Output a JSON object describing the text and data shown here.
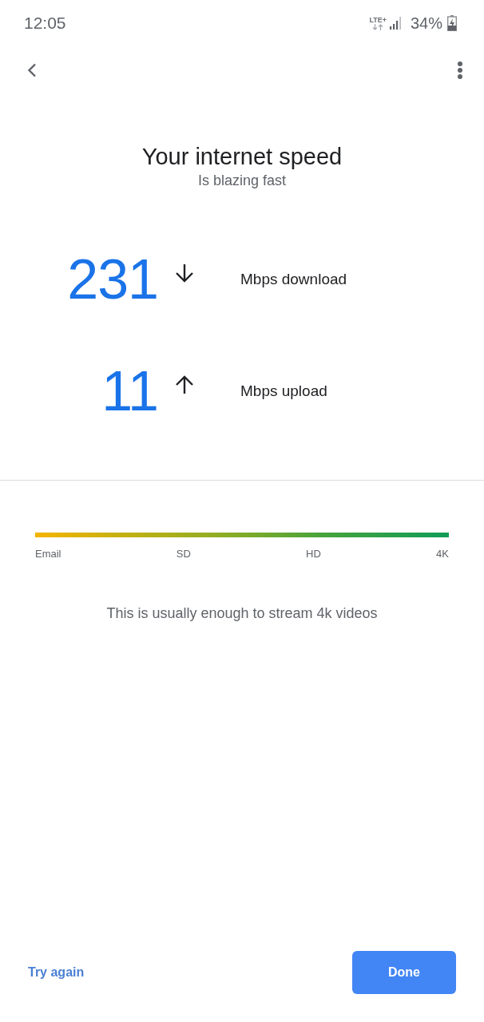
{
  "status_bar": {
    "time": "12:05",
    "network": "LTE+",
    "battery": "34%"
  },
  "header": {
    "title": "Your internet speed",
    "subtitle": "Is blazing fast"
  },
  "speeds": [
    {
      "kind": "download",
      "value": "231",
      "label": "Mbps download"
    },
    {
      "kind": "upload",
      "value": "11",
      "label": "Mbps upload"
    }
  ],
  "scale": {
    "labels": [
      "Email",
      "SD",
      "HD",
      "4K"
    ]
  },
  "message": "This is usually enough to stream 4k videos",
  "actions": {
    "secondary": "Try again",
    "primary": "Done"
  }
}
